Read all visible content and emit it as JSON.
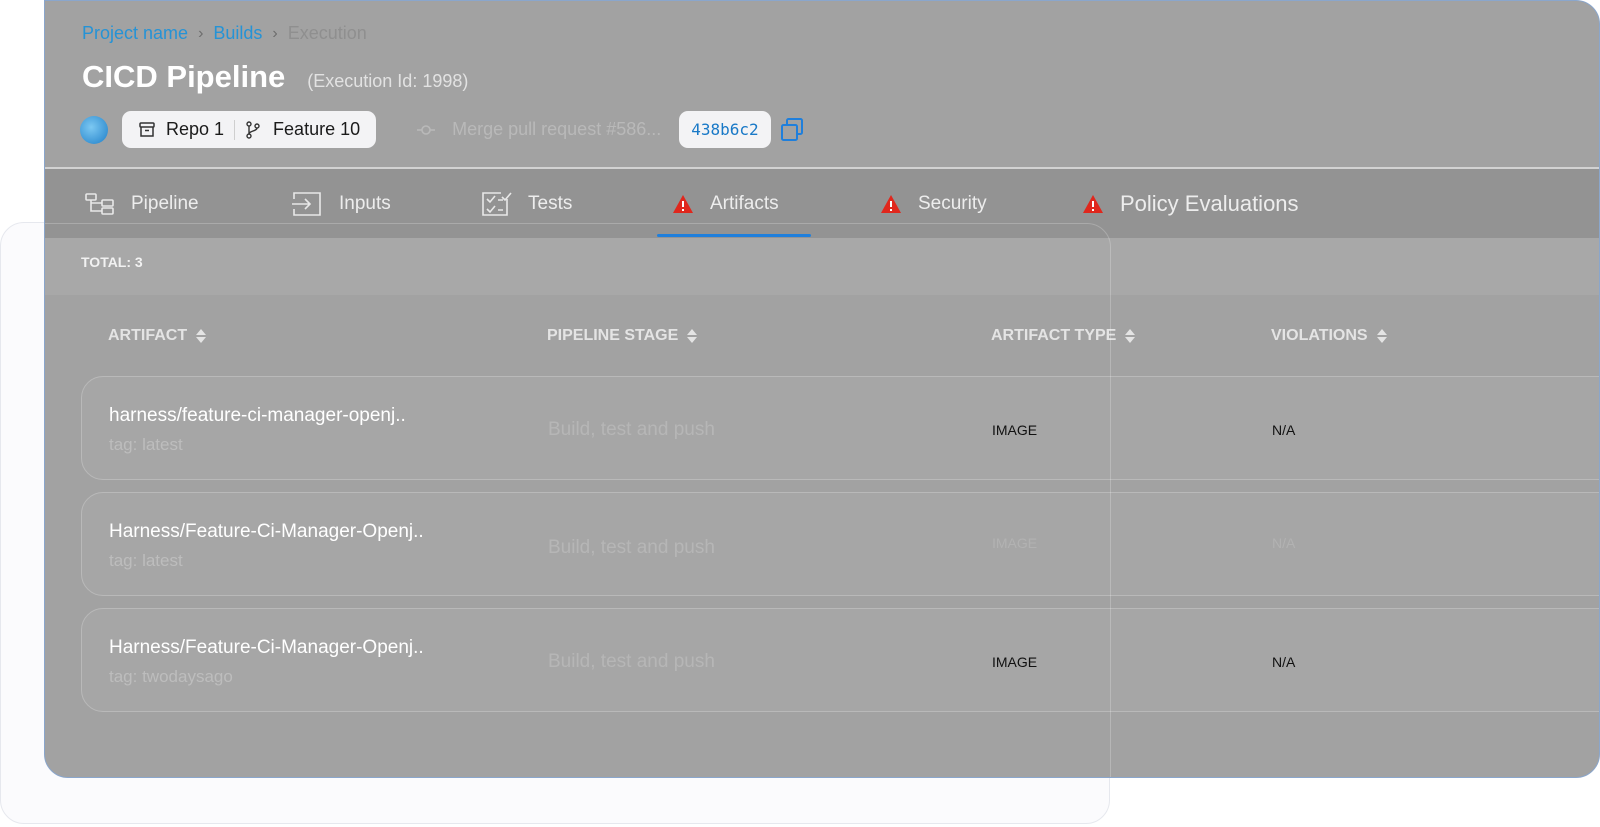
{
  "breadcrumb": {
    "project": "Project name",
    "builds": "Builds",
    "current": "Execution",
    "separator": "›"
  },
  "header": {
    "title": "CICD Pipeline",
    "execution_id": "(Execution Id: 1998)",
    "repo": "Repo 1",
    "branch": "Feature 10",
    "commit_message": "Merge pull request #586...",
    "commit_sha": "438b6c2"
  },
  "tabs": [
    {
      "label": "Pipeline",
      "icon": "pipeline-icon",
      "active": false
    },
    {
      "label": "Inputs",
      "icon": "inputs-icon",
      "active": false
    },
    {
      "label": "Tests",
      "icon": "tests-icon",
      "active": false
    },
    {
      "label": "Artifacts",
      "icon": "warning-icon",
      "active": true
    },
    {
      "label": "Security",
      "icon": "warning-icon",
      "active": false
    },
    {
      "label": "Policy Evaluations",
      "icon": "warning-icon",
      "active": false
    }
  ],
  "total": "TOTAL: 3",
  "table": {
    "columns": [
      "ARTIFACT",
      "PIPELINE STAGE",
      "ARTIFACT TYPE",
      "VIOLATIONS"
    ],
    "rows": [
      {
        "artifact": "harness/feature-ci-manager-openj..",
        "tag": "tag: latest",
        "stage": "Build, test and push",
        "type": "IMAGE",
        "violations": "N/A"
      },
      {
        "artifact": "Harness/Feature-Ci-Manager-Openj..",
        "tag": "tag: latest",
        "stage": "Build, test and push",
        "type": "IMAGE",
        "violations": "N/A"
      },
      {
        "artifact": "Harness/Feature-Ci-Manager-Openj..",
        "tag": "tag: twodaysago",
        "stage": "Build, test and push",
        "type": "IMAGE",
        "violations": "N/A"
      }
    ]
  },
  "colors": {
    "link": "#2593d6",
    "accent": "#1f7fdc",
    "warning": "#e0271d",
    "sha": "#1979c7"
  }
}
